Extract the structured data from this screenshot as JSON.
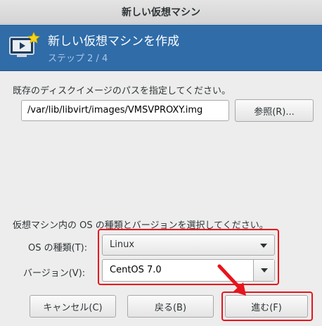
{
  "window": {
    "title": "新しい仮想マシン"
  },
  "banner": {
    "title": "新しい仮想マシンを作成",
    "step": "ステップ 2 / 4",
    "icon": "vm-screen-star-icon"
  },
  "storage": {
    "prompt": "既存のディスクイメージのパスを指定してください。",
    "path_value": "/var/lib/libvirt/images/VMSVPROXY.img",
    "browse_label": "参照(R)..."
  },
  "os": {
    "prompt": "仮想マシン内の OS の種類とバージョンを選択してください。",
    "type_label": "OS の種類(T):",
    "type_value": "Linux",
    "version_label": "バージョン(V):",
    "version_value": "CentOS 7.0"
  },
  "buttons": {
    "cancel": "キャンセル(C)",
    "back": "戻る(B)",
    "forward": "進む(F)"
  },
  "annotation": {
    "highlight_color": "#e8141b",
    "icon": "red-arrow-icon"
  }
}
